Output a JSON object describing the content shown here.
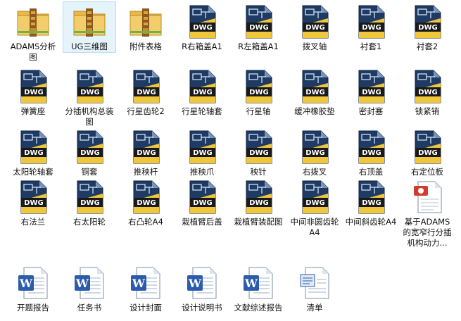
{
  "explorer": {
    "files": [
      {
        "label": "ADAMS分析图",
        "type": "folder"
      },
      {
        "label": "UG三维图",
        "type": "folder",
        "selected": true
      },
      {
        "label": "附件表格",
        "type": "folder"
      },
      {
        "label": "R右箱盖A1",
        "type": "dwg"
      },
      {
        "label": "R左箱盖A1",
        "type": "dwg"
      },
      {
        "label": "拨叉轴",
        "type": "dwg"
      },
      {
        "label": "衬套1",
        "type": "dwg"
      },
      {
        "label": "衬套2",
        "type": "dwg"
      },
      {
        "label": "弹簧座",
        "type": "dwg"
      },
      {
        "label": "分插机构总装图",
        "type": "dwg"
      },
      {
        "label": "行星齿轮2",
        "type": "dwg"
      },
      {
        "label": "行星轮轴套",
        "type": "dwg"
      },
      {
        "label": "行星轴",
        "type": "dwg"
      },
      {
        "label": "缓冲橡胶垫",
        "type": "dwg"
      },
      {
        "label": "密封塞",
        "type": "dwg"
      },
      {
        "label": "锁紧销",
        "type": "dwg"
      },
      {
        "label": "太阳轮轴套",
        "type": "dwg"
      },
      {
        "label": "铜套",
        "type": "dwg"
      },
      {
        "label": "推秧杆",
        "type": "dwg"
      },
      {
        "label": "推秧爪",
        "type": "dwg"
      },
      {
        "label": "秧针",
        "type": "dwg"
      },
      {
        "label": "右拨叉",
        "type": "dwg"
      },
      {
        "label": "右顶盖",
        "type": "dwg"
      },
      {
        "label": "右定位板",
        "type": "dwg"
      },
      {
        "label": "右法兰",
        "type": "dwg"
      },
      {
        "label": "右太阳轮",
        "type": "dwg"
      },
      {
        "label": "右凸轮A4",
        "type": "dwg"
      },
      {
        "label": "栽植臂后盖",
        "type": "dwg"
      },
      {
        "label": "栽植臂装配图",
        "type": "dwg"
      },
      {
        "label": "中间非圆齿轮A4",
        "type": "dwg"
      },
      {
        "label": "中间斜齿轮A4",
        "type": "dwg"
      },
      {
        "label": "基于ADAMS的宽窄行分插机构动力...",
        "type": "pdf"
      },
      {
        "label": "开题报告",
        "type": "word"
      },
      {
        "label": "任务书",
        "type": "word"
      },
      {
        "label": "设计封面",
        "type": "word"
      },
      {
        "label": "设计说明书",
        "type": "word"
      },
      {
        "label": "文献综述报告",
        "type": "word"
      },
      {
        "label": "清单",
        "type": "doc-outline"
      }
    ],
    "icon_badges": {
      "dwg": "DWG",
      "word": "W"
    },
    "colors": {
      "folder": "#e8b84a",
      "zip_band": "#8a5a1e",
      "dwg_body": "#1f3b63",
      "dwg_stripe": "#f0c63a",
      "word_blue": "#2b5cab",
      "pdf_red": "#d33b2c",
      "selection": "#e5f3fb"
    }
  }
}
